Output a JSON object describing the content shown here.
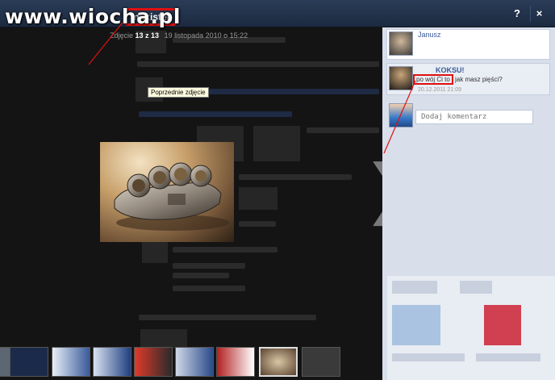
{
  "watermark": {
    "text": "www.wiocha.pl"
  },
  "header": {
    "album_title": "maxistet",
    "help_label": "?",
    "close_label": "×"
  },
  "photo": {
    "counter_prefix": "Zdjęcie",
    "counter_value": "13 z 13",
    "date": "19 listopada 2010 o 15:22",
    "prev_tooltip": "Poprzednie zdjęcie",
    "next_arrow": "❯"
  },
  "comments": [
    {
      "author": "Janusz",
      "text": "",
      "time": ""
    },
    {
      "author": "KOKSU!",
      "text_highlight": "po wój Ci to",
      "text_rest": "jak masz pięści?",
      "time": "20.12.2011 21:09"
    }
  ],
  "comment_input": {
    "placeholder": "Dodaj komentarz"
  },
  "filmstrip": {
    "count": 9,
    "active_index": 7
  },
  "colors": {
    "annotation_red": "#e01010",
    "header_bg": "#1c2a40",
    "link_blue": "#3b5998"
  }
}
